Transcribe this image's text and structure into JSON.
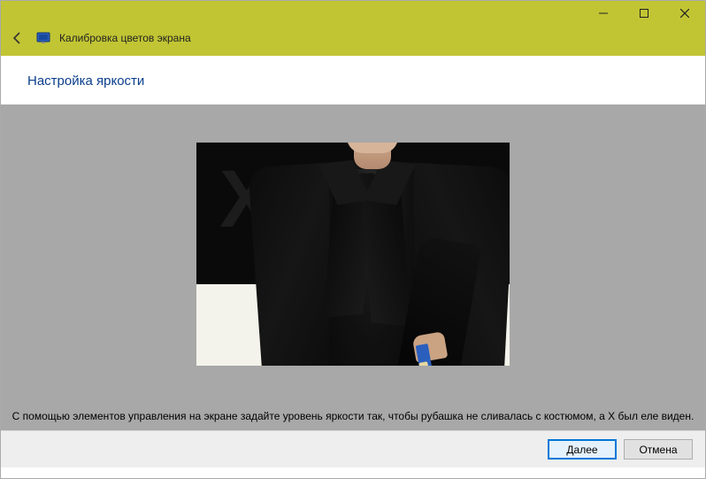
{
  "window": {
    "title": "Калибровка цветов экрана"
  },
  "page": {
    "heading": "Настройка яркости",
    "instruction": "С помощью элементов управления на экране задайте уровень яркости так, чтобы рубашка не сливалась с костюмом, а X был еле виден."
  },
  "buttons": {
    "next": "Далее",
    "cancel": "Отмена"
  }
}
